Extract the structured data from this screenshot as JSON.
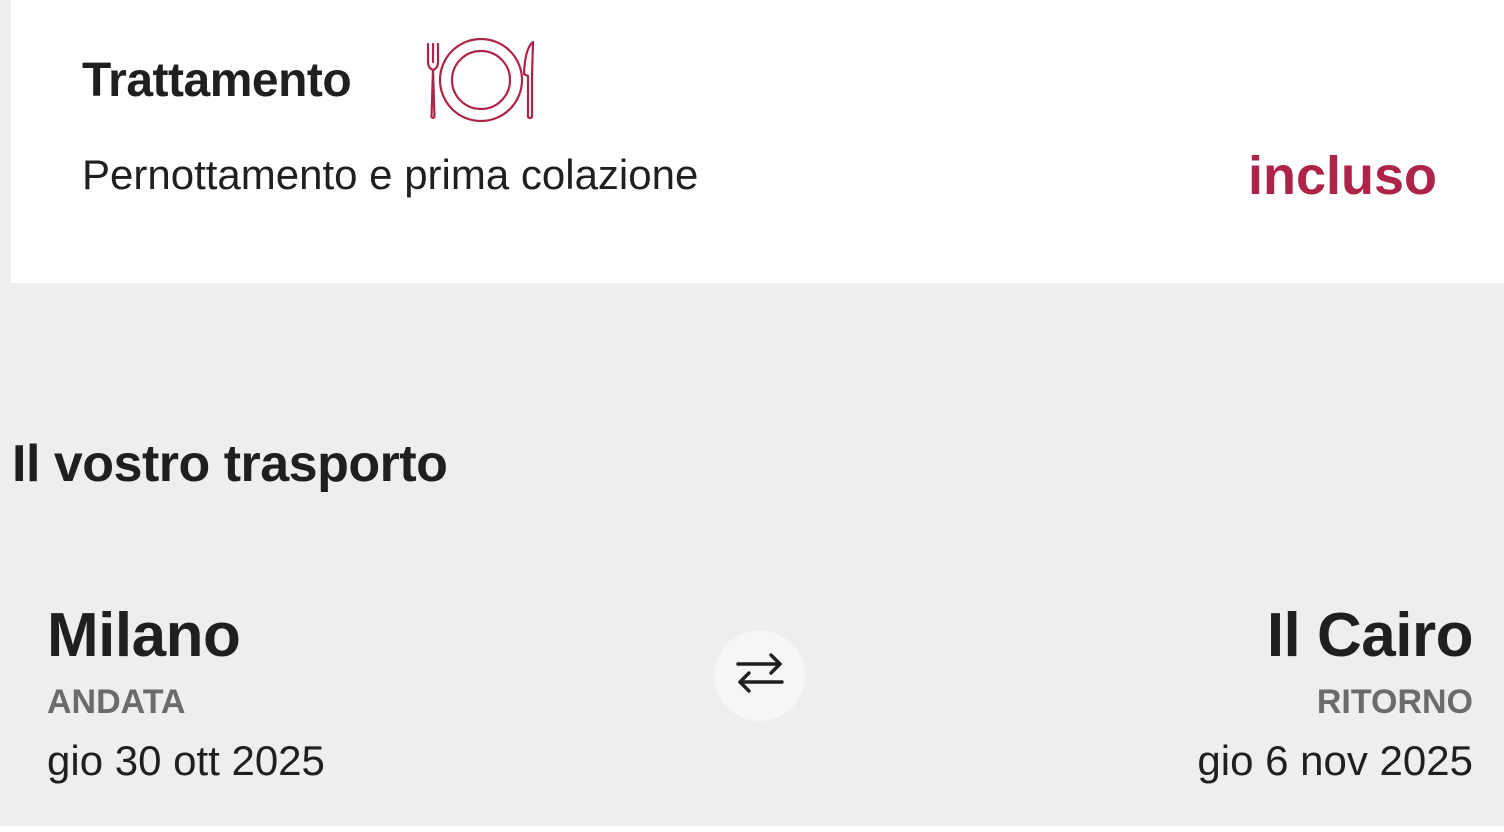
{
  "treatment": {
    "title": "Trattamento",
    "icon": "plate-fork-knife-icon",
    "description": "Pernottamento e prima colazione",
    "status": "incluso"
  },
  "transport": {
    "title": "Il vostro trasporto",
    "outbound": {
      "city": "Milano",
      "label": "ANDATA",
      "date": "gio 30 ott 2025"
    },
    "return": {
      "city": "Il Cairo",
      "label": "RITORNO",
      "date": "gio 6 nov 2025"
    },
    "swap_icon": "swap-arrows-icon"
  },
  "colors": {
    "accent": "#ae2448",
    "background": "#eeeeee",
    "card": "#ffffff",
    "muted": "#6b6b6b",
    "text": "#1f1f1f"
  }
}
